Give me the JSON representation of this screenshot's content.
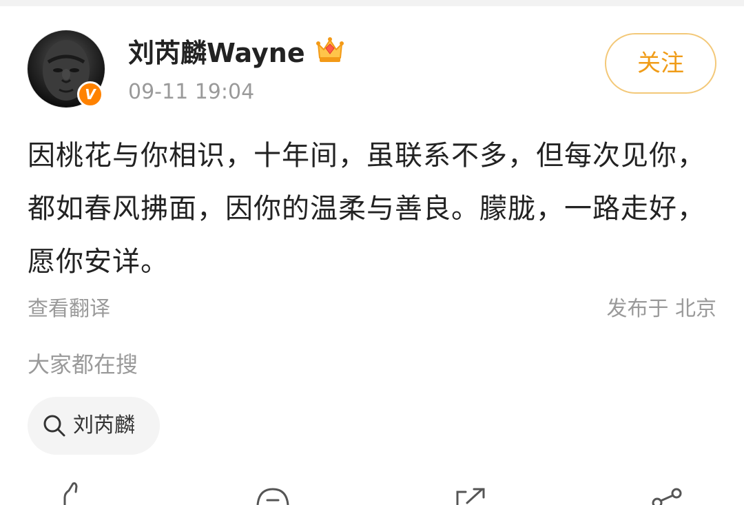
{
  "post": {
    "author": {
      "name": "刘芮麟Wayne",
      "verified_badge": "V"
    },
    "timestamp": "09-11 19:04",
    "follow_label": "关注",
    "text": "因桃花与你相识，十年间，虽联系不多，但每次见你，都如春风拂面，因你的温柔与善良。朦胧，一路走好，愿你安详。",
    "translate_label": "查看翻译",
    "location": "发布于 北京"
  },
  "trending": {
    "title": "大家都在搜",
    "chips": [
      {
        "label": "刘芮麟",
        "icon": "search-icon"
      }
    ]
  },
  "actions": [
    {
      "icon": "like-icon"
    },
    {
      "icon": "comment-icon"
    },
    {
      "icon": "repost-icon"
    },
    {
      "icon": "share-icon"
    }
  ],
  "colors": {
    "accent": "#ff8200",
    "follow_text": "#f09c18",
    "follow_border": "#f3c878",
    "muted_text": "#9a9a9a",
    "primary_text": "#222222",
    "chip_bg": "#f4f4f4"
  }
}
